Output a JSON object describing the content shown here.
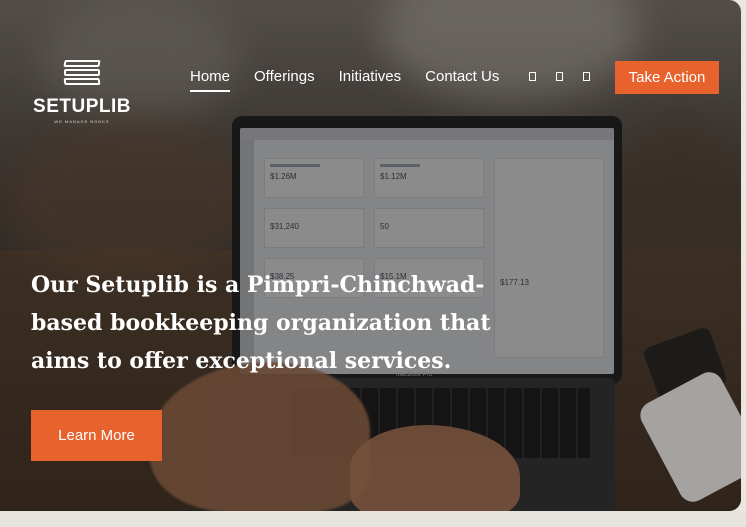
{
  "brand": {
    "name": "SETUPLIB",
    "tagline": "WE MANAGE BOOKS"
  },
  "nav": {
    "items": [
      {
        "label": "Home",
        "active": true
      },
      {
        "label": "Offerings",
        "active": false
      },
      {
        "label": "Initiatives",
        "active": false
      },
      {
        "label": "Contact Us",
        "active": false
      }
    ],
    "icons": [
      "facebook-icon",
      "twitter-icon",
      "instagram-icon"
    ],
    "cta_label": "Take Action"
  },
  "hero": {
    "headline": "Our Setuplib is a Pimpri-Chinchwad-based bookkeeping organization that aims to offer exceptional services.",
    "button_label": "Learn More"
  },
  "screen": {
    "figures": [
      "$1.26M",
      "$1.12M",
      "$31,240",
      "50",
      "$38.25",
      "$15.1M",
      "$177.13"
    ],
    "laptop_label": "MacBook Pro"
  },
  "colors": {
    "accent": "#e8622d",
    "text": "#ffffff"
  }
}
